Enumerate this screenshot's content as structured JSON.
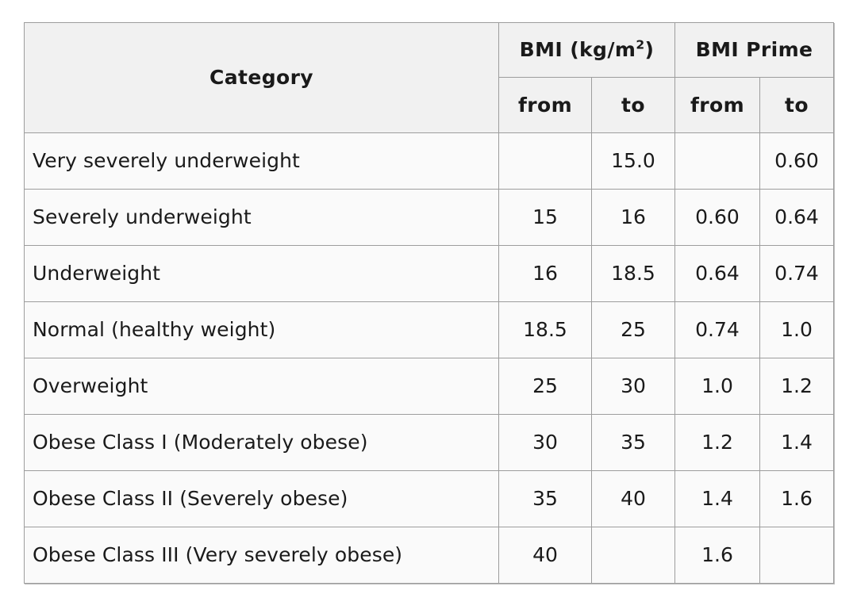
{
  "table": {
    "header": {
      "category_label": "Category",
      "bmi_label_main": "BMI (kg/m",
      "bmi_label_sup": "2",
      "bmi_label_tail": ")",
      "bmi_prime_label": "BMI Prime",
      "sub_bmi_from": "from",
      "sub_bmi_to": "to",
      "sub_prime_from": "from",
      "sub_prime_to": "to"
    },
    "rows": [
      {
        "category": "Very severely underweight",
        "bmi_from": "",
        "bmi_to": "15.0",
        "prime_from": "",
        "prime_to": "0.60"
      },
      {
        "category": "Severely underweight",
        "bmi_from": "15",
        "bmi_to": "16",
        "prime_from": "0.60",
        "prime_to": "0.64"
      },
      {
        "category": "Underweight",
        "bmi_from": "16",
        "bmi_to": "18.5",
        "prime_from": "0.64",
        "prime_to": "0.74"
      },
      {
        "category": "Normal (healthy weight)",
        "bmi_from": "18.5",
        "bmi_to": "25",
        "prime_from": "0.74",
        "prime_to": "1.0"
      },
      {
        "category": "Overweight",
        "bmi_from": "25",
        "bmi_to": "30",
        "prime_from": "1.0",
        "prime_to": "1.2"
      },
      {
        "category": "Obese Class I (Moderately obese)",
        "bmi_from": "30",
        "bmi_to": "35",
        "prime_from": "1.2",
        "prime_to": "1.4"
      },
      {
        "category": "Obese Class II (Severely obese)",
        "bmi_from": "35",
        "bmi_to": "40",
        "prime_from": "1.4",
        "prime_to": "1.6"
      },
      {
        "category": "Obese Class III (Very severely obese)",
        "bmi_from": "40",
        "bmi_to": "",
        "prime_from": "1.6",
        "prime_to": ""
      }
    ]
  },
  "colors": {
    "border": "#9d9d9d",
    "header_bg": "#f1f1f1",
    "body_bg": "#fafafa",
    "text": "#1a1a1a",
    "page_bg": "#ffffff"
  }
}
